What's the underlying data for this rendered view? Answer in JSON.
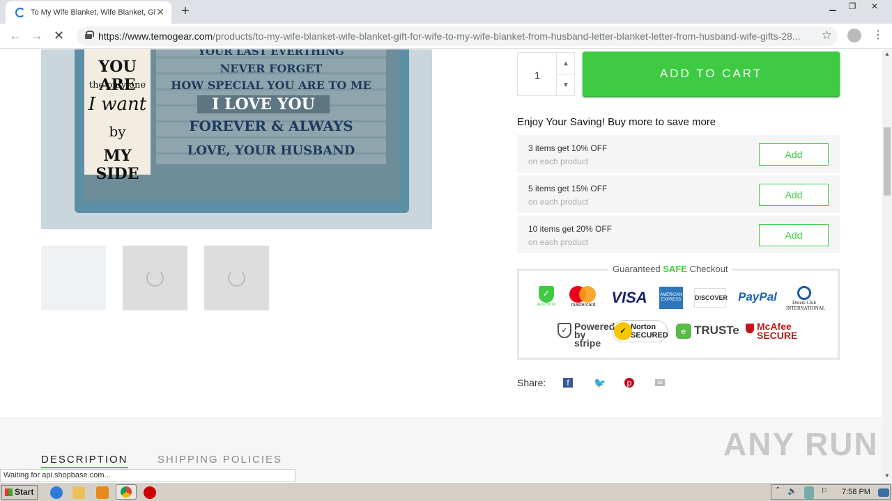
{
  "browser": {
    "tab_title": "To My Wife Blanket, Wife Blanket, Gift",
    "new_tab": "+",
    "url_host": "https://www.temogear.com",
    "url_path": "/products/to-my-wife-blanket-wife-blanket-gift-for-wife-to-my-wife-blanket-from-husband-letter-blanket-letter-from-husband-wife-gifts-28...",
    "status": "Waiting for api.shopbase.com..."
  },
  "product_image": {
    "lines": [
      "YOUR LAST EVERTHING",
      "NEVER FORGET",
      "HOW SPECIAL YOU ARE TO ME",
      "I LOVE YOU",
      "FOREVER & ALWAYS",
      "LOVE, YOUR HUSBAND"
    ],
    "left": [
      "YOU ARE",
      "the only one",
      "I want",
      "by",
      "MY SIDE"
    ]
  },
  "purchase": {
    "quantity": "1",
    "add_to_cart": "ADD TO CART",
    "promo_heading": "Enjoy Your Saving! Buy more to save more",
    "offers": [
      {
        "title": "3 items get 10% OFF",
        "sub": "on each product",
        "button": "Add"
      },
      {
        "title": "5 items get 15% OFF",
        "sub": "on each product",
        "button": "Add"
      },
      {
        "title": "10 items get 20% OFF",
        "sub": "on each product",
        "button": "Add"
      }
    ]
  },
  "checkout": {
    "title_pre": "Guaranteed ",
    "title_safe": "SAFE",
    "title_post": " Checkout",
    "logos": [
      "AES-256 bit",
      "mastercard",
      "VISA",
      "AMERICAN EXPRESS",
      "DISCOVER",
      "PayPal",
      "Diners Club INTERNATIONAL",
      "Powered by stripe",
      "Norton SECURED",
      "TRUSTe",
      "McAfee SECURE"
    ]
  },
  "share": {
    "label": "Share:"
  },
  "tabs": {
    "description": "DESCRIPTION",
    "shipping": "SHIPPING POLICIES"
  },
  "watermark": "ANY RUN",
  "taskbar": {
    "start": "Start",
    "clock": "7:58 PM"
  },
  "colors": {
    "accent_green": "#3ecb43",
    "facebook": "#3b5998",
    "twitter": "#1da1f2",
    "pinterest": "#bd081c"
  }
}
